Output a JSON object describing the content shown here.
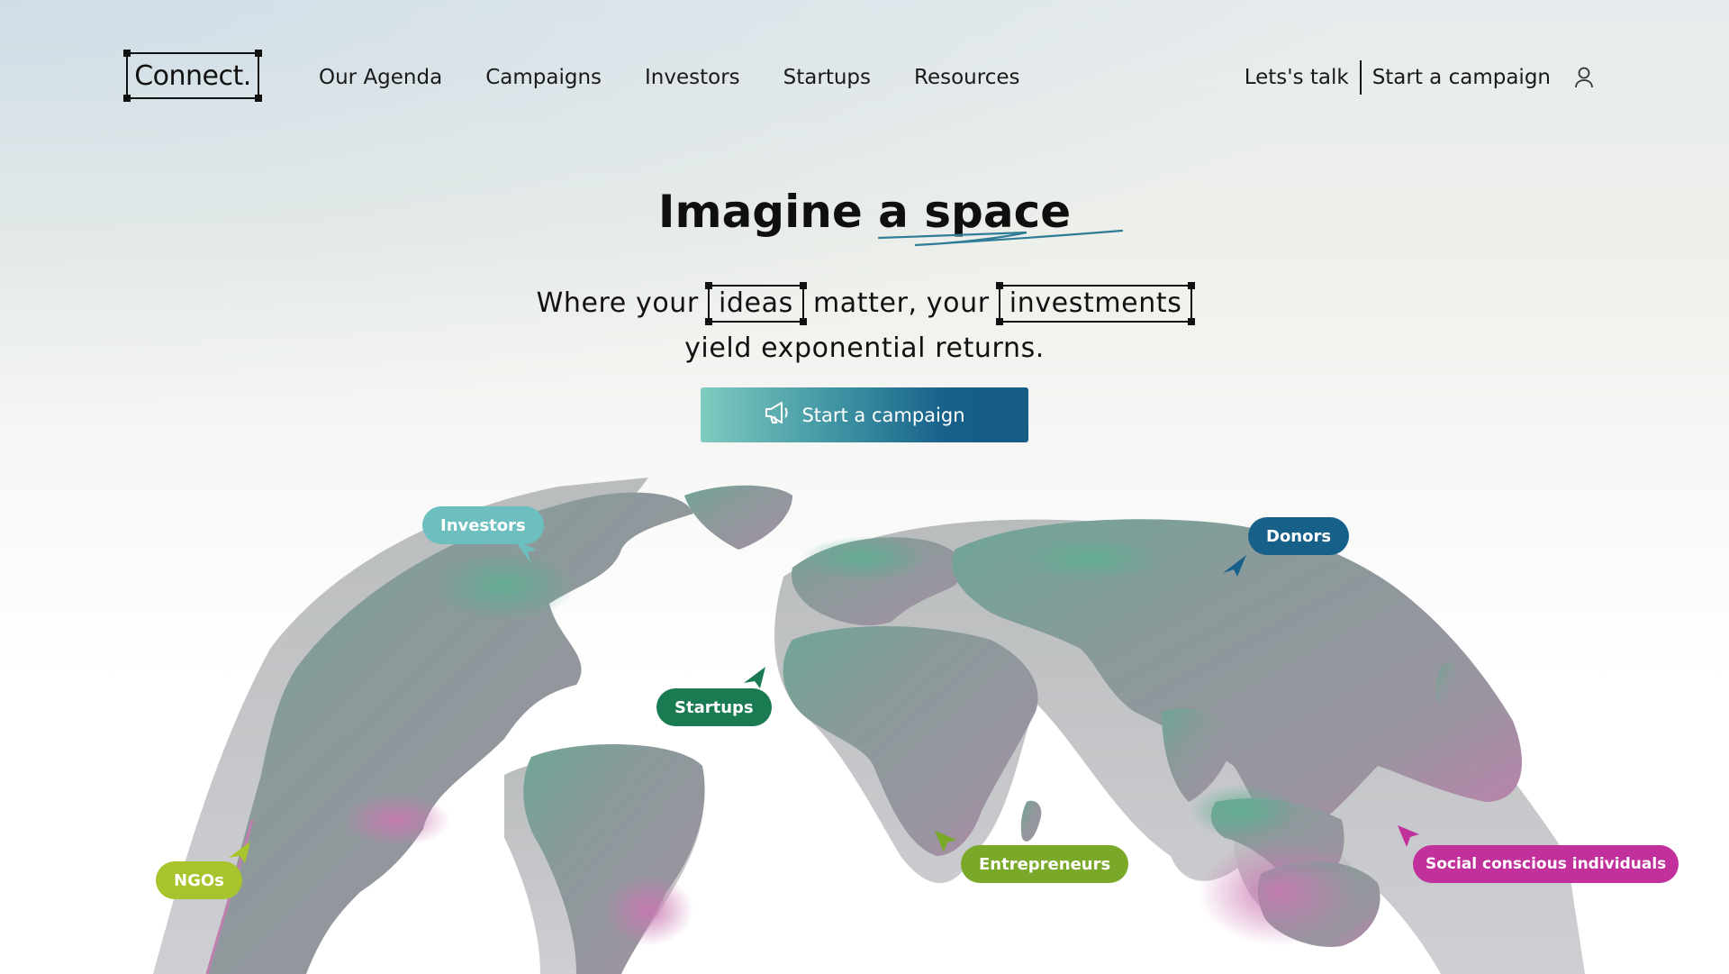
{
  "header": {
    "logo": "Connect.",
    "nav": [
      "Our Agenda",
      "Campaigns",
      "Investors",
      "Startups",
      "Resources"
    ],
    "right": {
      "talk": "Lets's talk",
      "campaign": "Start a campaign",
      "user_icon": "user-icon"
    }
  },
  "hero": {
    "title": "Imagine a space",
    "subtitle": {
      "part1": "Where your",
      "box1": "ideas",
      "part2": "matter, your",
      "box2": "investments",
      "part3": "yield exponential returns."
    },
    "cta": {
      "label": "Start a campaign",
      "icon": "megaphone-icon"
    }
  },
  "tags": {
    "investors": {
      "label": "Investors",
      "color": "#6dbfbf"
    },
    "donors": {
      "label": "Donors",
      "color": "#17608a"
    },
    "startups": {
      "label": "Startups",
      "color": "#1a7a52"
    },
    "entrepreneurs": {
      "label": "Entrepreneurs",
      "color": "#7aa828"
    },
    "ngos": {
      "label": "NGOs",
      "color": "#a7c42c"
    },
    "social": {
      "label": "Social conscious individuals",
      "color": "#c2309b"
    }
  }
}
